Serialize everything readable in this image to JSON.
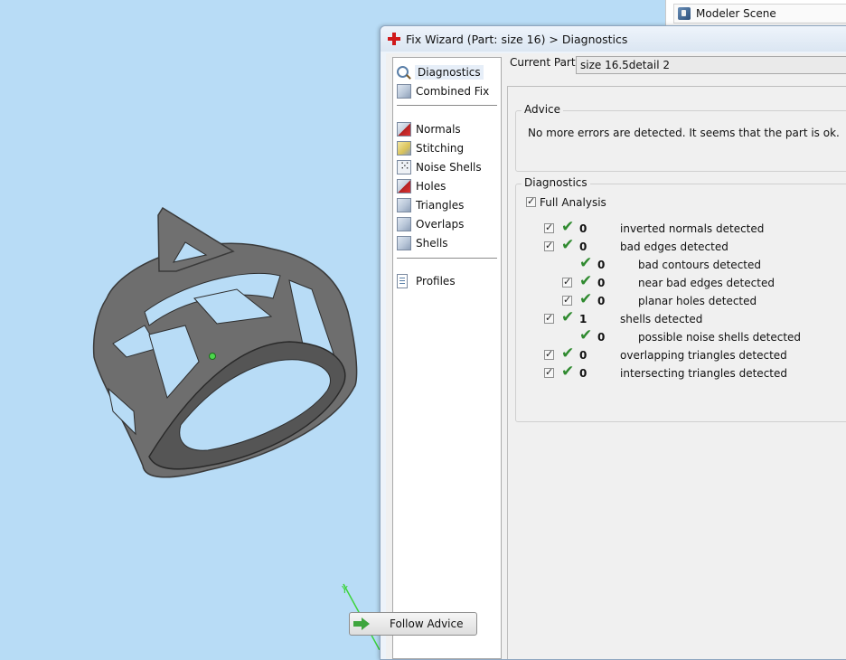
{
  "scene": {
    "tab_label": "Modeler Scene"
  },
  "dialog": {
    "title": "Fix Wizard (Part: size 16) > Diagnostics",
    "current_part_label": "Current Part:",
    "current_part_value": "size 16.5detail 2"
  },
  "nav": {
    "top": [
      {
        "label": "Diagnostics",
        "icon": "magnifier-icon",
        "selected": true
      },
      {
        "label": "Combined Fix",
        "icon": "cube-icon"
      }
    ],
    "fixes": [
      {
        "label": "Normals",
        "icon": "normals-cube-icon"
      },
      {
        "label": "Stitching",
        "icon": "stitching-cube-icon"
      },
      {
        "label": "Noise Shells",
        "icon": "dice-icon"
      },
      {
        "label": "Holes",
        "icon": "holes-cube-icon"
      },
      {
        "label": "Triangles",
        "icon": "triangles-cube-icon"
      },
      {
        "label": "Overlaps",
        "icon": "overlaps-cube-icon"
      },
      {
        "label": "Shells",
        "icon": "shells-cube-icon"
      }
    ],
    "bottom": [
      {
        "label": "Profiles",
        "icon": "document-icon"
      }
    ]
  },
  "advice": {
    "title": "Advice",
    "text": "No more errors are detected. It seems that the part is ok."
  },
  "diagnostics": {
    "title": "Diagnostics",
    "full_analysis_label": "Full Analysis",
    "full_analysis_checked": true,
    "rows": [
      {
        "count": "0",
        "label": "inverted normals detected",
        "level": 0,
        "checkbox": true
      },
      {
        "count": "0",
        "label": "bad edges detected",
        "level": 0,
        "checkbox": true
      },
      {
        "count": "0",
        "label": "bad contours detected",
        "level": 1,
        "checkbox": false
      },
      {
        "count": "0",
        "label": "near bad edges detected",
        "level": 1,
        "checkbox": true
      },
      {
        "count": "0",
        "label": "planar holes detected",
        "level": 1,
        "checkbox": true
      },
      {
        "count": "1",
        "label": "shells detected",
        "level": 0,
        "checkbox": true
      },
      {
        "count": "0",
        "label": "possible noise shells detected",
        "level": 1,
        "checkbox": false
      },
      {
        "count": "0",
        "label": "overlapping triangles detected",
        "level": 0,
        "checkbox": true
      },
      {
        "count": "0",
        "label": "intersecting triangles detected",
        "level": 0,
        "checkbox": true
      }
    ]
  },
  "buttons": {
    "follow_advice": "Follow Advice"
  },
  "colors": {
    "viewport_bg": "#b8dcf6",
    "ok_check": "#2f8a2f",
    "axis_green": "#3bd43b",
    "model_gray": "#6b6b6b"
  }
}
